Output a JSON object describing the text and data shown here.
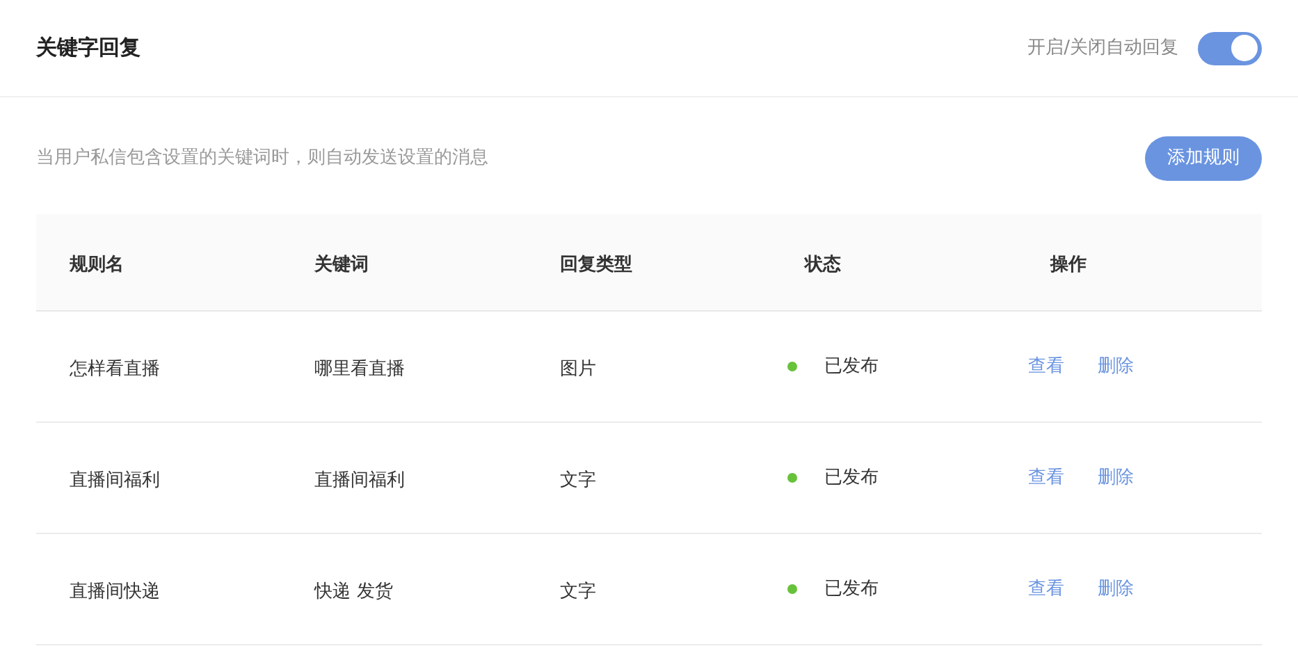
{
  "header": {
    "title": "关键字回复",
    "toggle_label": "开启/关闭自动回复",
    "toggle_on": true
  },
  "description": "当用户私信包含设置的关键词时，则自动发送设置的消息",
  "add_button": "添加规则",
  "table": {
    "columns": [
      "规则名",
      "关键词",
      "回复类型",
      "状态",
      "操作"
    ],
    "rows": [
      {
        "name": "怎样看直播",
        "keywords": "哪里看直播",
        "type": "图片",
        "status": "已发布",
        "color": "#67c23a",
        "actions": [
          "查看",
          "删除"
        ]
      },
      {
        "name": "直播间福利",
        "keywords": "直播间福利",
        "type": "文字",
        "status": "已发布",
        "color": "#67c23a",
        "actions": [
          "查看",
          "删除"
        ]
      },
      {
        "name": "直播间快递",
        "keywords": "快递 发货",
        "type": "文字",
        "status": "已发布",
        "color": "#67c23a",
        "actions": [
          "查看",
          "删除"
        ]
      }
    ]
  }
}
